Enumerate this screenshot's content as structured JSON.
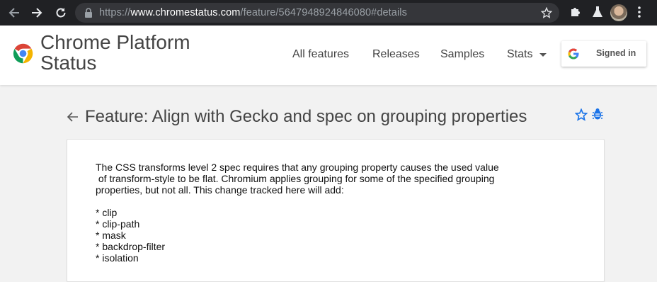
{
  "browser": {
    "url_prefix": "https://",
    "url_host": "www.chromestatus.com",
    "url_path": "/feature/5647948924846080#details"
  },
  "header": {
    "title_line1": "Chrome Platform",
    "title_line2": "Status",
    "nav": [
      {
        "label": "All features"
      },
      {
        "label": "Releases"
      },
      {
        "label": "Samples"
      },
      {
        "label": "Stats"
      }
    ],
    "signin_label": "Signed in"
  },
  "feature": {
    "title": "Feature: Align with Gecko and spec on grouping properties",
    "summary_lines": [
      "The CSS transforms level 2 spec requires that any grouping property causes the used value",
      " of transform-style to be flat. Chromium applies grouping for some of the specified grouping",
      "properties, but not all. This change tracked here will add:",
      "",
      "* clip",
      "* clip-path",
      "* mask",
      "* backdrop-filter",
      "* isolation"
    ]
  },
  "colors": {
    "browser_bar": "#202124",
    "omnibox": "#35363a",
    "accent_blue": "#1a73e8",
    "text": "#444444"
  }
}
